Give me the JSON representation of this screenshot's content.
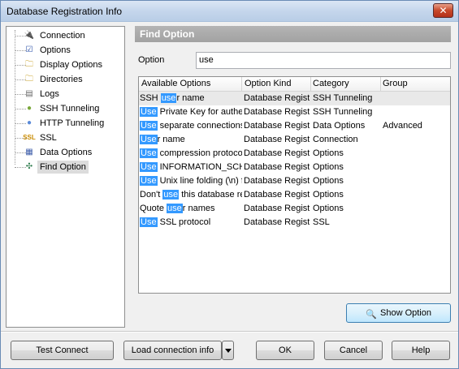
{
  "window": {
    "title": "Database Registration Info",
    "close_glyph": "✕"
  },
  "nav": {
    "items": [
      {
        "label": "Connection",
        "icon": "connection-plug-icon",
        "glyph": "🔌",
        "color": "#3a8a2a"
      },
      {
        "label": "Options",
        "icon": "options-checklist-icon",
        "glyph": "☑",
        "color": "#2a4fa8"
      },
      {
        "label": "Display Options",
        "icon": "display-options-folder-icon",
        "glyph": "🗀",
        "color": "#c9a227"
      },
      {
        "label": "Directories",
        "icon": "directories-folder-icon",
        "glyph": "🗀",
        "color": "#c9a227"
      },
      {
        "label": "Logs",
        "icon": "logs-notepad-icon",
        "glyph": "▤",
        "color": "#6a6a6a"
      },
      {
        "label": "SSH Tunneling",
        "icon": "ssh-tunneling-icon",
        "glyph": "●",
        "color": "#7aa83a"
      },
      {
        "label": "HTTP Tunneling",
        "icon": "http-tunneling-icon",
        "glyph": "●",
        "color": "#5a8ad8"
      },
      {
        "label": "SSL",
        "icon": "ssl-icon",
        "glyph": "SSL",
        "color": "#c98a00"
      },
      {
        "label": "Data Options",
        "icon": "data-options-icon",
        "glyph": "▦",
        "color": "#3a5aa8"
      },
      {
        "label": "Find Option",
        "icon": "find-option-arrows-icon",
        "glyph": "✣",
        "color": "#2a7a4a"
      }
    ],
    "selected_index": 9
  },
  "panel": {
    "header": "Find Option",
    "option_label": "Option",
    "option_value": "use",
    "columns": [
      "Available Options",
      "Option Kind",
      "Category",
      "Group"
    ],
    "rows": [
      {
        "pre": "SSH ",
        "match": "use",
        "post": "r name",
        "kind": "Database Registr",
        "category": "SSH Tunneling",
        "group": ""
      },
      {
        "pre": "",
        "match": "Use",
        "post": " Private Key for authen",
        "kind": "Database Registr",
        "category": "SSH Tunneling",
        "group": ""
      },
      {
        "pre": "",
        "match": "Use",
        "post": " separate connections",
        "kind": "Database Registr",
        "category": "Data Options",
        "group": "Advanced"
      },
      {
        "pre": "",
        "match": "Use",
        "post": "r name",
        "kind": "Database Registr",
        "category": "Connection",
        "group": ""
      },
      {
        "pre": "",
        "match": "Use",
        "post": " compression protocol",
        "kind": "Database Registr",
        "category": "Options",
        "group": ""
      },
      {
        "pre": "",
        "match": "Use",
        "post": " INFORMATION_SCHE",
        "kind": "Database Registr",
        "category": "Options",
        "group": ""
      },
      {
        "pre": "",
        "match": "Use",
        "post": " Unix line folding (\\n) fo",
        "kind": "Database Registr",
        "category": "Options",
        "group": ""
      },
      {
        "pre": "Don't ",
        "match": "use",
        "post": " this database re",
        "kind": "Database Registr",
        "category": "Options",
        "group": ""
      },
      {
        "pre": "Quote ",
        "match": "use",
        "post": "r names",
        "kind": "Database Registr",
        "category": "Options",
        "group": ""
      },
      {
        "pre": "",
        "match": "Use",
        "post": " SSL protocol",
        "kind": "Database Registr",
        "category": "SSL",
        "group": ""
      }
    ],
    "show_option_label": "Show Option",
    "show_option_icon": "magnifier-icon"
  },
  "buttons": {
    "test_connect": "Test Connect",
    "load_connection_info": "Load connection info",
    "ok": "OK",
    "cancel": "Cancel",
    "help": "Help"
  },
  "colors": {
    "highlight": "#3399ff",
    "header_bar": "#a8a8a8"
  }
}
